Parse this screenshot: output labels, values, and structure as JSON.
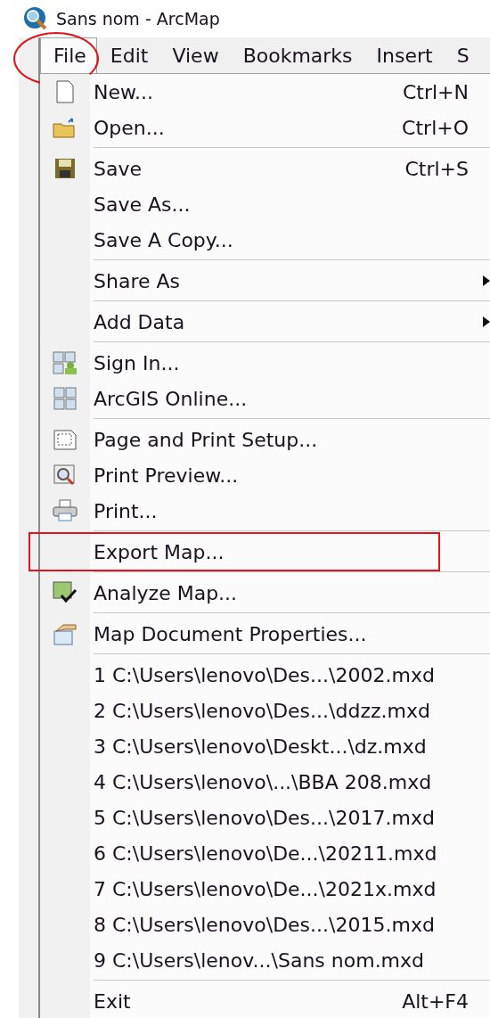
{
  "window": {
    "title": "Sans nom - ArcMap"
  },
  "menu_bar": [
    {
      "label": "File",
      "selected": true,
      "annotated": true
    },
    {
      "label": "Edit",
      "selected": false,
      "annotated": false
    },
    {
      "label": "View",
      "selected": false,
      "annotated": false
    },
    {
      "label": "Bookmarks",
      "selected": false,
      "annotated": false
    },
    {
      "label": "Insert",
      "selected": false,
      "annotated": false
    },
    {
      "label": "S",
      "selected": false,
      "annotated": false
    }
  ],
  "file_menu": [
    {
      "kind": "item",
      "label": "New...",
      "shortcut": "Ctrl+N",
      "annotated": false
    },
    {
      "kind": "item",
      "label": "Open...",
      "shortcut": "Ctrl+O",
      "annotated": false
    },
    {
      "kind": "separator"
    },
    {
      "kind": "item",
      "label": "Save",
      "shortcut": "Ctrl+S",
      "annotated": false
    },
    {
      "kind": "item",
      "label": "Save As...",
      "annotated": false
    },
    {
      "kind": "item",
      "label": "Save A Copy...",
      "annotated": false
    },
    {
      "kind": "separator"
    },
    {
      "kind": "submenu",
      "label": "Share As",
      "annotated": false
    },
    {
      "kind": "separator"
    },
    {
      "kind": "submenu",
      "label": "Add Data",
      "annotated": false
    },
    {
      "kind": "separator"
    },
    {
      "kind": "item",
      "label": "Sign In...",
      "annotated": false
    },
    {
      "kind": "item",
      "label": "ArcGIS Online...",
      "annotated": false
    },
    {
      "kind": "separator"
    },
    {
      "kind": "item",
      "label": "Page and Print Setup...",
      "annotated": false
    },
    {
      "kind": "item",
      "label": "Print Preview...",
      "annotated": false
    },
    {
      "kind": "item",
      "label": "Print...",
      "annotated": false
    },
    {
      "kind": "separator"
    },
    {
      "kind": "item",
      "label": "Export Map...",
      "annotated": true
    },
    {
      "kind": "separator"
    },
    {
      "kind": "item",
      "label": "Analyze Map...",
      "annotated": false
    },
    {
      "kind": "separator"
    },
    {
      "kind": "item",
      "label": "Map Document Properties...",
      "annotated": false
    },
    {
      "kind": "separator"
    },
    {
      "kind": "item",
      "label": "1 C:\\Users\\lenovo\\Des...\\2002.mxd",
      "annotated": false
    },
    {
      "kind": "item",
      "label": "2 C:\\Users\\lenovo\\Des...\\ddzz.mxd",
      "annotated": false
    },
    {
      "kind": "item",
      "label": "3 C:\\Users\\lenovo\\Deskt...\\dz.mxd",
      "annotated": false
    },
    {
      "kind": "item",
      "label": "4 C:\\Users\\lenovo\\...\\BBA 208.mxd",
      "annotated": false
    },
    {
      "kind": "item",
      "label": "5 C:\\Users\\lenovo\\Des...\\2017.mxd",
      "annotated": false
    },
    {
      "kind": "item",
      "label": "6 C:\\Users\\lenovo\\De...\\20211.mxd",
      "annotated": false
    },
    {
      "kind": "item",
      "label": "7 C:\\Users\\lenovo\\De...\\2021x.mxd",
      "annotated": false
    },
    {
      "kind": "item",
      "label": "8 C:\\Users\\lenovo\\Des...\\2015.mxd",
      "annotated": false
    },
    {
      "kind": "item",
      "label": "9 C:\\Users\\lenov...\\Sans nom.mxd",
      "annotated": false
    },
    {
      "kind": "separator"
    },
    {
      "kind": "item",
      "label": "Exit",
      "shortcut": "Alt+F4",
      "annotated": false
    }
  ]
}
